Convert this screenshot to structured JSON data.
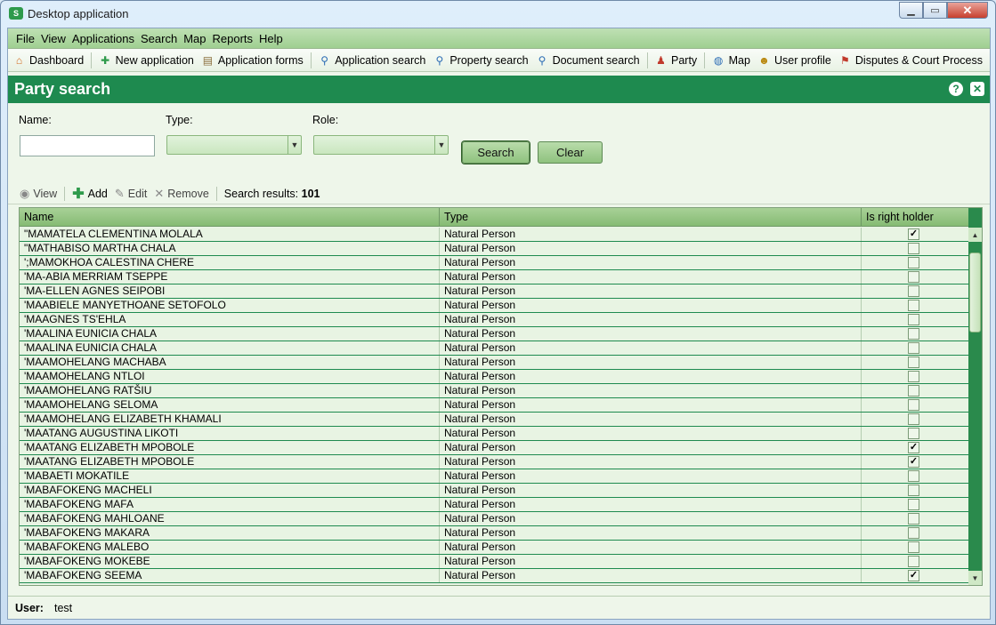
{
  "window": {
    "title": "Desktop application",
    "app_icon": "sola-icon"
  },
  "menu": [
    "File",
    "View",
    "Applications",
    "Search",
    "Map",
    "Reports",
    "Help"
  ],
  "toolbar": [
    {
      "label": "Dashboard",
      "icon": "home-icon"
    },
    {
      "label": "New application",
      "icon": "new-document-icon"
    },
    {
      "label": "Application forms",
      "icon": "forms-icon"
    },
    {
      "label": "Application search",
      "icon": "magnifier-icon"
    },
    {
      "label": "Property search",
      "icon": "magnifier-icon"
    },
    {
      "label": "Document search",
      "icon": "magnifier-icon"
    },
    {
      "label": "Party",
      "icon": "party-icon"
    },
    {
      "label": "Map",
      "icon": "globe-icon"
    },
    {
      "label": "User profile",
      "icon": "user-icon"
    },
    {
      "label": "Disputes & Court Process",
      "icon": "gavel-icon"
    }
  ],
  "panel": {
    "title": "Party search",
    "help_icon": "?",
    "close_icon": "✕"
  },
  "form": {
    "name_label": "Name:",
    "name_value": "",
    "type_label": "Type:",
    "type_value": "",
    "role_label": "Role:",
    "role_value": "",
    "search_button": "Search",
    "clear_button": "Clear"
  },
  "actions": {
    "view": "View",
    "add": "Add",
    "edit": "Edit",
    "remove": "Remove",
    "results_label": "Search results:",
    "results_count": "101"
  },
  "table": {
    "columns": [
      "Name",
      "Type",
      "Is right holder"
    ],
    "rows": [
      {
        "name": "\"MAMATELA CLEMENTINA MOLALA",
        "type": "Natural Person",
        "right_holder": true
      },
      {
        "name": "\"MATHABISO MARTHA CHALA",
        "type": "Natural Person",
        "right_holder": false
      },
      {
        "name": "';MAMOKHOA CALESTINA CHERE",
        "type": "Natural Person",
        "right_holder": false
      },
      {
        "name": "'MA-ABIA MERRIAM TSEPPE",
        "type": "Natural Person",
        "right_holder": false
      },
      {
        "name": "'MA-ELLEN AGNES SEIPOBI",
        "type": "Natural Person",
        "right_holder": false
      },
      {
        "name": "'MAABIELE MANYETHOANE SETOFOLO",
        "type": "Natural Person",
        "right_holder": false
      },
      {
        "name": "'MAAGNES TS'EHLA",
        "type": "Natural Person",
        "right_holder": false
      },
      {
        "name": "'MAALINA EUNICIA CHALA",
        "type": "Natural Person",
        "right_holder": false
      },
      {
        "name": "'MAALINA EUNICIA CHALA",
        "type": "Natural Person",
        "right_holder": false
      },
      {
        "name": "'MAAMOHELANG MACHABA",
        "type": "Natural Person",
        "right_holder": false
      },
      {
        "name": "'MAAMOHELANG NTLOI",
        "type": "Natural Person",
        "right_holder": false
      },
      {
        "name": "'MAAMOHELANG RATŠIU",
        "type": "Natural Person",
        "right_holder": false
      },
      {
        "name": "'MAAMOHELANG SELOMA",
        "type": "Natural Person",
        "right_holder": false
      },
      {
        "name": "'MAAMOHELANG ELIZABETH KHAMALI",
        "type": "Natural Person",
        "right_holder": false
      },
      {
        "name": "'MAATANG  AUGUSTINA LIKOTI",
        "type": "Natural Person",
        "right_holder": false
      },
      {
        "name": "'MAATANG ELIZABETH MPOBOLE",
        "type": "Natural Person",
        "right_holder": true
      },
      {
        "name": "'MAATANG ELIZABETH MPOBOLE",
        "type": "Natural Person",
        "right_holder": true
      },
      {
        "name": "'MABAETI MOKATILE",
        "type": "Natural Person",
        "right_holder": false
      },
      {
        "name": "'MABAFOKENG MACHELI",
        "type": "Natural Person",
        "right_holder": false
      },
      {
        "name": "'MABAFOKENG MAFA",
        "type": "Natural Person",
        "right_holder": false
      },
      {
        "name": "'MABAFOKENG MAHLOANE",
        "type": "Natural Person",
        "right_holder": false
      },
      {
        "name": "'MABAFOKENG MAKARA",
        "type": "Natural Person",
        "right_holder": false
      },
      {
        "name": "'MABAFOKENG MALEBO",
        "type": "Natural Person",
        "right_holder": false
      },
      {
        "name": "'MABAFOKENG MOKEBE",
        "type": "Natural Person",
        "right_holder": false
      },
      {
        "name": "'MABAFOKENG SEEMA",
        "type": "Natural Person",
        "right_holder": true
      }
    ]
  },
  "status": {
    "user_label": "User:",
    "user_value": "test"
  }
}
